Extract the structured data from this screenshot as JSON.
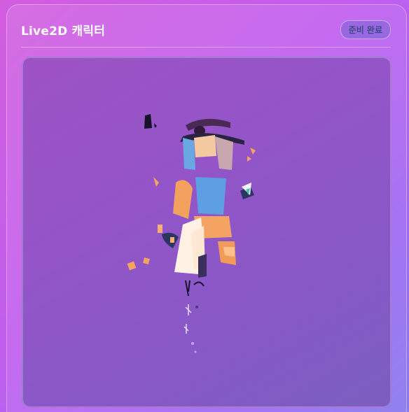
{
  "header": {
    "title": "Live2D 캐릭터",
    "status": "준비 완료"
  },
  "colors": {
    "accent": "#c05ef0",
    "stage": "#9355c8",
    "badge_text": "#3f4a8a"
  },
  "icons": {
    "character": "live2d-character-render"
  }
}
